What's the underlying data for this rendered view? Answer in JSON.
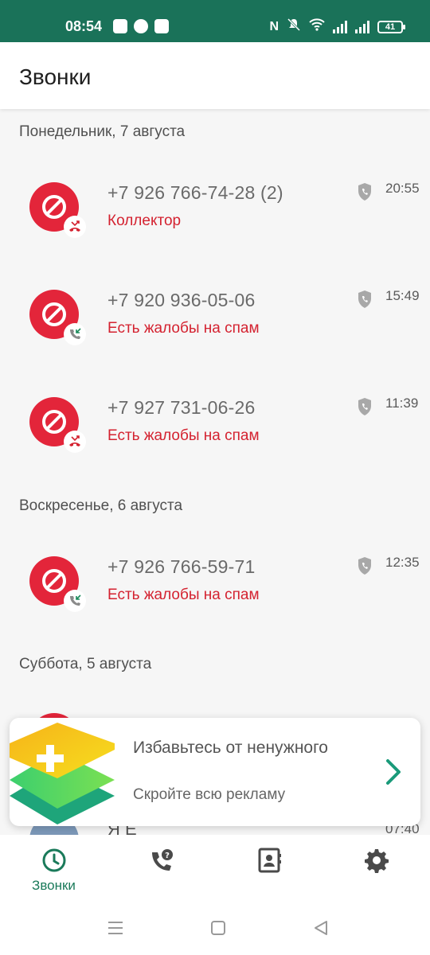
{
  "status_bar": {
    "time": "08:54",
    "battery": "41",
    "icons": [
      "app-notification-icon",
      "pinterest-icon",
      "chat-icon",
      "nfc-icon",
      "mute-icon",
      "wifi-icon",
      "signal-icon",
      "signal-icon",
      "battery-icon"
    ]
  },
  "header": {
    "title": "Звонки"
  },
  "sections": [
    {
      "date": "Понедельник, 7 августа",
      "calls": [
        {
          "number": "+7 926 766-74-28 (2)",
          "label": "Коллектор",
          "time": "20:55",
          "type": "missed"
        },
        {
          "number": "+7 920 936-05-06",
          "label": "Есть жалобы на спам",
          "time": "15:49",
          "type": "incoming"
        },
        {
          "number": "+7 927 731-06-26",
          "label": "Есть жалобы на спам",
          "time": "11:39",
          "type": "missed"
        }
      ]
    },
    {
      "date": "Воскресенье, 6 августа",
      "calls": [
        {
          "number": "+7 926 766-59-71",
          "label": "Есть жалобы на спам",
          "time": "12:35",
          "type": "incoming"
        }
      ]
    },
    {
      "date": "Суббота, 5 августа",
      "calls": [
        {
          "number": "Я Е",
          "label": "",
          "time": "07:40",
          "type": "incoming"
        }
      ]
    }
  ],
  "promo": {
    "title": "Избавьтесь от ненужного",
    "subtitle": "Скройте всю рекламу"
  },
  "bottom_nav": {
    "items": [
      {
        "label": "Звонки",
        "icon": "clock-icon",
        "active": true
      },
      {
        "label": "",
        "icon": "phone-question-icon",
        "active": false
      },
      {
        "label": "",
        "icon": "contacts-icon",
        "active": false
      },
      {
        "label": "",
        "icon": "gear-icon",
        "active": false
      }
    ]
  },
  "colors": {
    "status_bar": "#1a7259",
    "spam_red": "#e3253a",
    "label_red": "#d42230",
    "accent_green": "#1a7a5a"
  }
}
